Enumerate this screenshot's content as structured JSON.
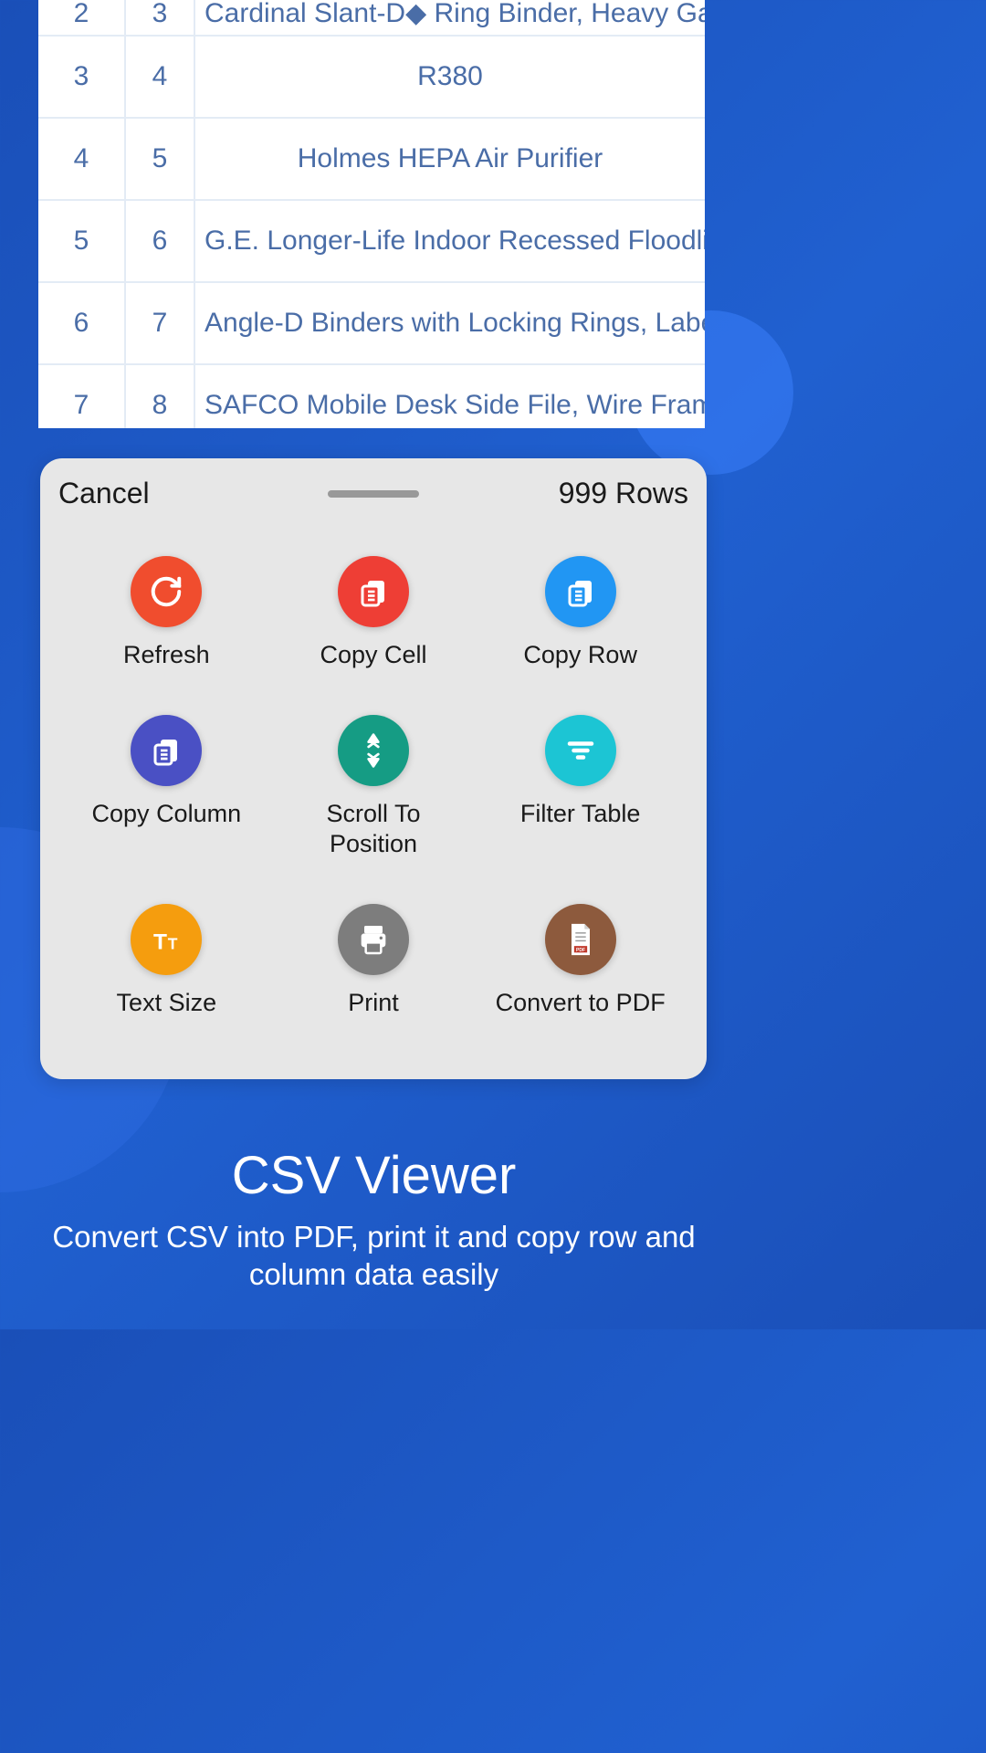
{
  "table": {
    "rows": [
      {
        "col1": "2",
        "col2": "3",
        "col3": "Cardinal Slant-D◆ Ring Binder, Heavy Gauge"
      },
      {
        "col1": "3",
        "col2": "4",
        "col3": "R380"
      },
      {
        "col1": "4",
        "col2": "5",
        "col3": "Holmes HEPA Air Purifier"
      },
      {
        "col1": "5",
        "col2": "6",
        "col3": "G.E. Longer-Life Indoor Recessed Floodlight"
      },
      {
        "col1": "6",
        "col2": "7",
        "col3": "Angle-D Binders with Locking Rings, Label Ho"
      },
      {
        "col1": "7",
        "col2": "8",
        "col3": "SAFCO Mobile Desk Side File, Wire Fram"
      }
    ]
  },
  "sheet": {
    "cancel": "Cancel",
    "rows_count": "999 Rows",
    "actions": {
      "refresh": "Refresh",
      "copy_cell": "Copy Cell",
      "copy_row": "Copy Row",
      "copy_column": "Copy Column",
      "scroll_to_position": "Scroll To\nPosition",
      "filter_table": "Filter Table",
      "text_size": "Text Size",
      "print": "Print",
      "convert_to_pdf": "Convert to PDF"
    }
  },
  "promo": {
    "title": "CSV  Viewer",
    "subtitle": "Convert CSV into PDF, print it and copy row and column data easily"
  }
}
